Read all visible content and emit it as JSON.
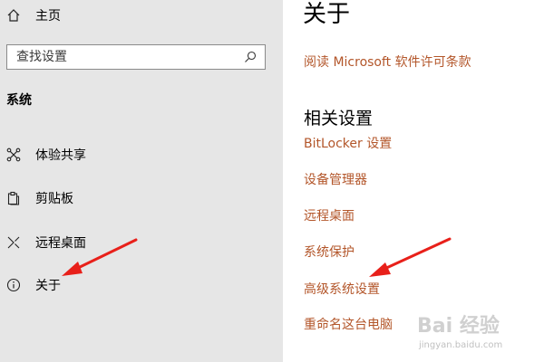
{
  "sidebar": {
    "home_label": "主页",
    "search_placeholder": "查找设置",
    "section_title": "系统",
    "items": [
      {
        "label": "体验共享",
        "icon": "share-icon"
      },
      {
        "label": "剪贴板",
        "icon": "clipboard-icon"
      },
      {
        "label": "远程桌面",
        "icon": "remote-desktop-icon"
      },
      {
        "label": "关于",
        "icon": "info-icon"
      }
    ]
  },
  "main": {
    "title": "关于",
    "license_link": "阅读 Microsoft 软件许可条款",
    "related_title": "相关设置",
    "related_links": [
      "BitLocker 设置",
      "设备管理器",
      "远程桌面",
      "系统保护",
      "高级系统设置",
      "重命名这台电脑"
    ]
  },
  "watermark": {
    "brand": "Bai 经验",
    "url": "jingyan.baidu.com"
  },
  "colors": {
    "sidebar_bg": "#e6e6e6",
    "link": "#b3562a",
    "arrow": "#e8201a"
  }
}
